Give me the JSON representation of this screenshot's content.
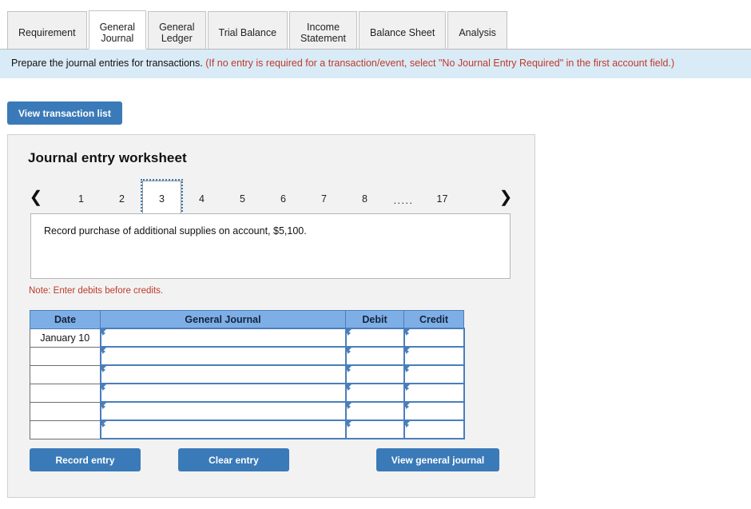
{
  "tabs": [
    {
      "label": "Requirement",
      "active": false
    },
    {
      "label": "General\nJournal",
      "active": true
    },
    {
      "label": "General\nLedger",
      "active": false
    },
    {
      "label": "Trial Balance",
      "active": false
    },
    {
      "label": "Income\nStatement",
      "active": false
    },
    {
      "label": "Balance Sheet",
      "active": false
    },
    {
      "label": "Analysis",
      "active": false
    }
  ],
  "banner": {
    "main": "Prepare the journal entries for transactions. ",
    "note": "(If no entry is required for a transaction/event, select \"No Journal Entry Required\" in the first account field.)"
  },
  "toolbar": {
    "view_transaction_list": "View transaction list"
  },
  "worksheet": {
    "title": "Journal entry worksheet",
    "pager": {
      "prev_icon": "chevron-left-icon",
      "next_icon": "chevron-right-icon",
      "pages": [
        "1",
        "2",
        "3",
        "4",
        "5",
        "6",
        "7",
        "8"
      ],
      "ellipsis": ".....",
      "last_page": "17",
      "active_page": "3"
    },
    "transaction_text": "Record purchase of additional supplies on account, $5,100.",
    "note": "Note: Enter debits before credits.",
    "table": {
      "headers": [
        "Date",
        "General Journal",
        "Debit",
        "Credit"
      ],
      "rows": [
        {
          "date": "January 10",
          "general_journal": "",
          "debit": "",
          "credit": ""
        },
        {
          "date": "",
          "general_journal": "",
          "debit": "",
          "credit": ""
        },
        {
          "date": "",
          "general_journal": "",
          "debit": "",
          "credit": ""
        },
        {
          "date": "",
          "general_journal": "",
          "debit": "",
          "credit": ""
        },
        {
          "date": "",
          "general_journal": "",
          "debit": "",
          "credit": ""
        },
        {
          "date": "",
          "general_journal": "",
          "debit": "",
          "credit": ""
        }
      ]
    },
    "buttons": {
      "record": "Record entry",
      "clear": "Clear entry",
      "view_general_journal": "View general journal"
    }
  },
  "colors": {
    "accent_blue": "#3b7ab8",
    "table_header_blue": "#7eaee6",
    "cell_border_blue": "#4a7ebb",
    "banner_bg": "#d9ebf7",
    "panel_bg": "#f2f2f2",
    "note_red": "#c0392b"
  }
}
